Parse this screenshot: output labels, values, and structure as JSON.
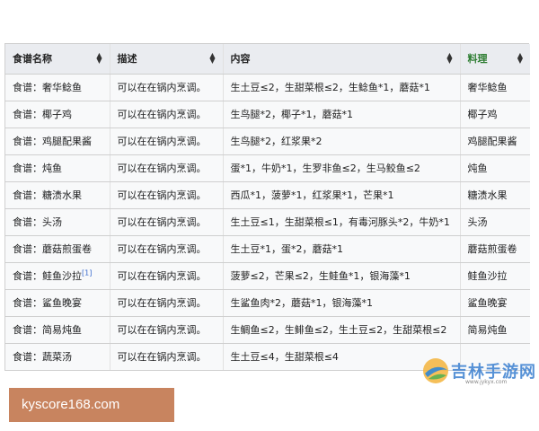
{
  "table": {
    "headers": {
      "name": "食谱名称",
      "desc": "描述",
      "content": "内容",
      "result": "料理"
    },
    "rows": [
      {
        "name": "食谱：奢华鲶鱼",
        "ref": "",
        "desc": "可以在在锅内烹调。",
        "content": "生土豆≤2，生甜菜根≤2，生鲶鱼*1，蘑菇*1",
        "result": "奢华鲶鱼"
      },
      {
        "name": "食谱：椰子鸡",
        "ref": "",
        "desc": "可以在在锅内烹调。",
        "content": "生鸟腿*2，椰子*1，蘑菇*1",
        "result": "椰子鸡"
      },
      {
        "name": "食谱：鸡腿配果酱",
        "ref": "",
        "desc": "可以在在锅内烹调。",
        "content": "生鸟腿*2，红浆果*2",
        "result": "鸡腿配果酱"
      },
      {
        "name": "食谱：炖鱼",
        "ref": "",
        "desc": "可以在在锅内烹调。",
        "content": "蛋*1，牛奶*1，生罗非鱼≤2，生马鲛鱼≤2",
        "result": "炖鱼"
      },
      {
        "name": "食谱：糖渍水果",
        "ref": "",
        "desc": "可以在在锅内烹调。",
        "content": "西瓜*1，菠萝*1，红浆果*1，芒果*1",
        "result": "糖渍水果"
      },
      {
        "name": "食谱：头汤",
        "ref": "",
        "desc": "可以在在锅内烹调。",
        "content": "生土豆≤1，生甜菜根≤1，有毒河豚头*2，牛奶*1",
        "result": "头汤"
      },
      {
        "name": "食谱：蘑菇煎蛋卷",
        "ref": "",
        "desc": "可以在在锅内烹调。",
        "content": "生土豆*1，蛋*2，蘑菇*1",
        "result": "蘑菇煎蛋卷"
      },
      {
        "name": "食谱：鲑鱼沙拉",
        "ref": "[1]",
        "desc": "可以在在锅内烹调。",
        "content": "菠萝≤2，芒果≤2，生鲑鱼*1，银海藻*1",
        "result": "鲑鱼沙拉"
      },
      {
        "name": "食谱：鲨鱼晚宴",
        "ref": "",
        "desc": "可以在在锅内烹调。",
        "content": "生鲨鱼肉*2，蘑菇*1，银海藻*1",
        "result": "鲨鱼晚宴"
      },
      {
        "name": "食谱：简易炖鱼",
        "ref": "",
        "desc": "可以在在锅内烹调。",
        "content": "生鲷鱼≤2，生鲱鱼≤2，生土豆≤2，生甜菜根≤2",
        "result": "简易炖鱼"
      },
      {
        "name": "食谱：蔬菜汤",
        "ref": "",
        "desc": "可以在在锅内烹调。",
        "content": "生土豆≤4，生甜菜根≤4",
        "result": ""
      }
    ]
  },
  "watermark": {
    "site": "kyscore168.com",
    "logo_text": "吉林手游网",
    "logo_sub": "www.jykyx.com"
  },
  "colors": {
    "header_bg": "#eaecf0",
    "row_bg": "#f8f9fa",
    "result_header": "#2e7d32",
    "watermark_bar": "#c8845f",
    "ref_link": "#3366cc"
  },
  "icons": {
    "sort": "sort-icon"
  }
}
